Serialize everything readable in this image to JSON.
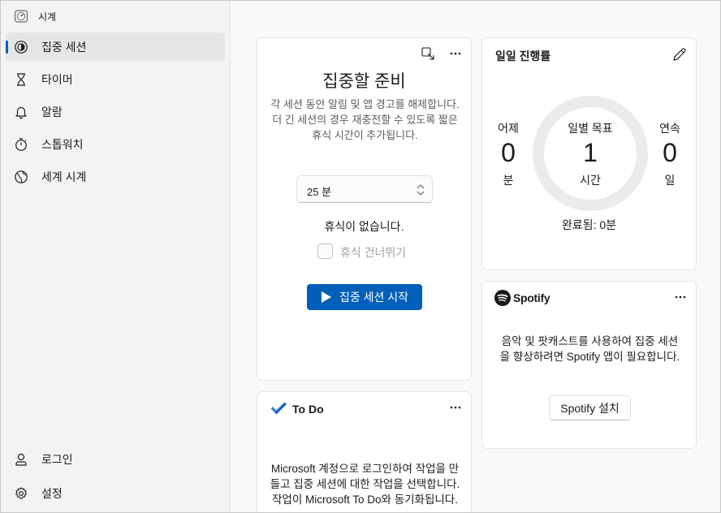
{
  "app": {
    "title": "시계",
    "window_controls": [
      "minimize-icon",
      "maximize-icon",
      "close-icon"
    ]
  },
  "sidebar": {
    "items": [
      {
        "label": "집중 세션",
        "icon": "focus-icon",
        "active": true
      },
      {
        "label": "타이머",
        "icon": "hourglass-icon",
        "active": false
      },
      {
        "label": "알람",
        "icon": "bell-icon",
        "active": false
      },
      {
        "label": "스톱워치",
        "icon": "stopwatch-icon",
        "active": false
      },
      {
        "label": "세계 시계",
        "icon": "globe-icon",
        "active": false
      }
    ],
    "bottom": [
      {
        "label": "로그인",
        "icon": "person-icon"
      },
      {
        "label": "설정",
        "icon": "gear-icon"
      }
    ]
  },
  "focus": {
    "title": "집중할 준비",
    "description": "각 세션 동안 알림 및 앱 경고를 해제합니다. 더 긴 세션의 경우 재충전할 수 있도록 짧은 휴식 시간이 추가됩니다.",
    "duration_value": "25 분",
    "no_break_text": "휴식이 없습니다.",
    "skip_break_label": "휴식 건너뛰기",
    "skip_break_checked": false,
    "start_label": "집중 세션 시작"
  },
  "progress": {
    "title": "일일 진행률",
    "yesterday": {
      "label": "어제",
      "value": "0",
      "unit": "분"
    },
    "goal": {
      "label": "일별 목표",
      "value": "1",
      "unit": "시간"
    },
    "streak": {
      "label": "연속",
      "value": "0",
      "unit": "일"
    },
    "completed_text": "완료됨: 0분",
    "progress_fraction": 0
  },
  "spotify": {
    "logo_text": "Spotify",
    "description": "음악 및 팟캐스트를 사용하여 집중 세션을 향상하려면 Spotify 앱이 필요합니다.",
    "install_label": "Spotify 설치"
  },
  "todo": {
    "title": "To Do",
    "description": "Microsoft 계정으로 로그인하여 작업을 만들고 집중 세션에 대한 작업을 선택합니다. 작업이 Microsoft To Do와 동기화됩니다."
  },
  "colors": {
    "accent": "#005fb8",
    "ring": "#ebebeb",
    "spotify_logo": "#1b1b1b"
  }
}
